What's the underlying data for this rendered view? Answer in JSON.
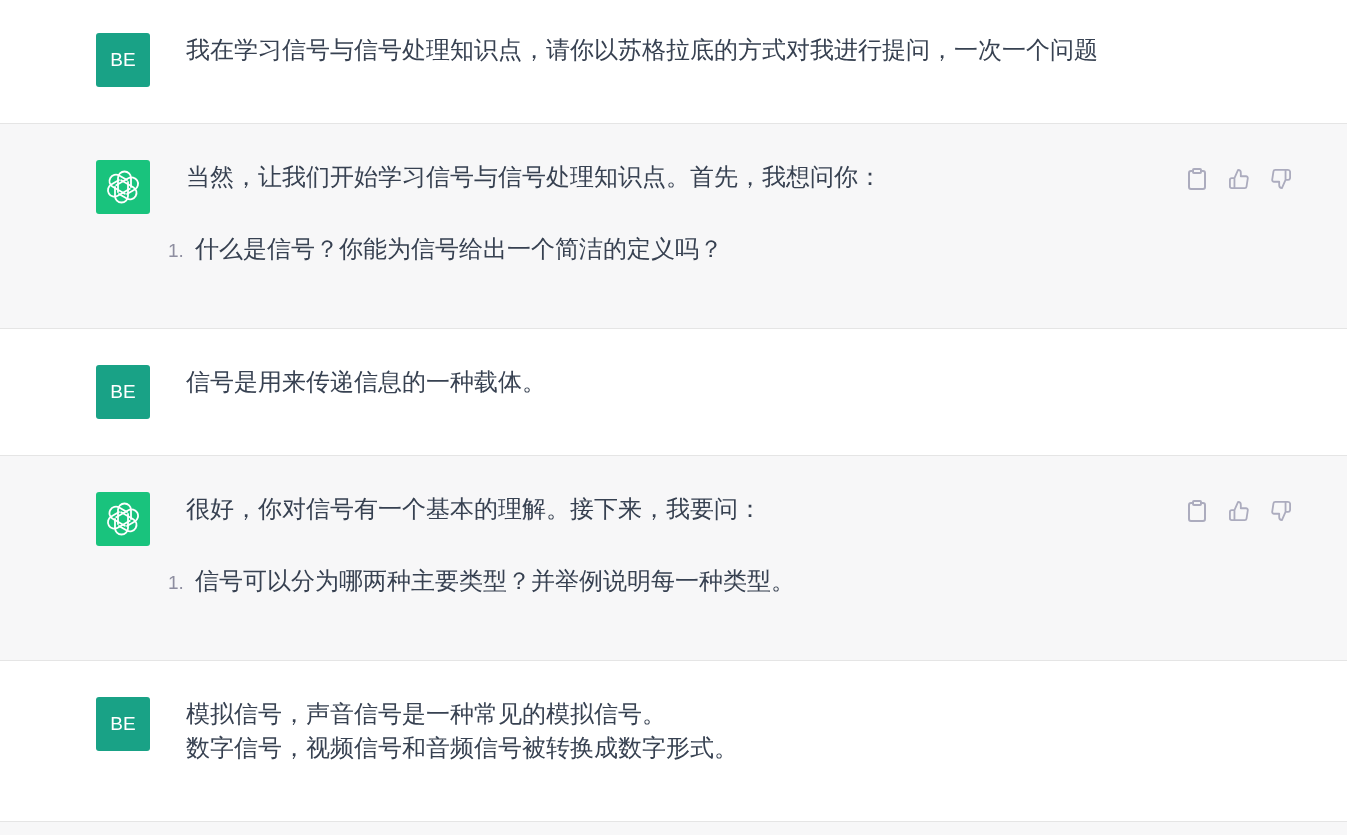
{
  "messages": [
    {
      "kind": "user",
      "avatar": "BE",
      "lines": [
        "我在学习信号与信号处理知识点，请你以苏格拉底的方式对我进行提问，一次一个问题"
      ]
    },
    {
      "kind": "assistant",
      "paragraphs": [
        "当然，让我们开始学习信号与信号处理知识点。首先，我想问你："
      ],
      "list": [
        {
          "number": "1.",
          "text": "什么是信号？你能为信号给出一个简洁的定义吗？"
        }
      ]
    },
    {
      "kind": "user",
      "avatar": "BE",
      "lines": [
        "信号是用来传递信息的一种载体。"
      ]
    },
    {
      "kind": "assistant",
      "paragraphs": [
        "很好，你对信号有一个基本的理解。接下来，我要问："
      ],
      "list": [
        {
          "number": "1.",
          "text": "信号可以分为哪两种主要类型？并举例说明每一种类型。"
        }
      ]
    },
    {
      "kind": "user",
      "avatar": "BE",
      "lines": [
        "模拟信号，声音信号是一种常见的模拟信号。",
        "数字信号，视频信号和音频信号被转换成数字形式。"
      ]
    }
  ]
}
